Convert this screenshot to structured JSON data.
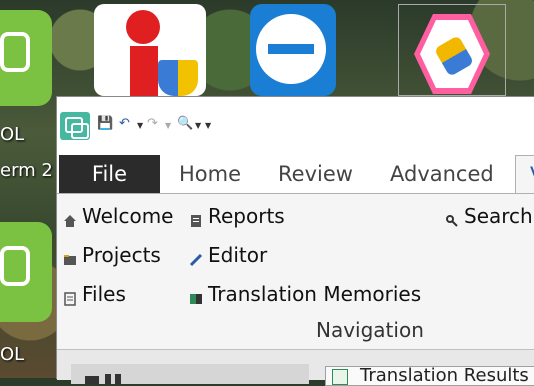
{
  "desktop": {
    "labels": [
      {
        "text": "OL"
      },
      {
        "text": "erm 2"
      },
      {
        "text": "OL"
      }
    ]
  },
  "window": {
    "quick_access": {
      "save": "save",
      "undo": "undo",
      "redo": "redo",
      "preview": "preview"
    },
    "tabs": {
      "file": "File",
      "home": "Home",
      "review": "Review",
      "advanced": "Advanced",
      "view": "V"
    },
    "ribbon": {
      "welcome": "Welcome",
      "reports": "Reports",
      "search": "Search",
      "projects": "Projects",
      "editor": "Editor",
      "files": "Files",
      "translation_memories": "Translation Memories",
      "group_label": "Navigation"
    },
    "bottom": {
      "result_tab": "Translation Results"
    }
  },
  "colors": {
    "file_tab_bg": "#2b2b2b",
    "accent": "#2a5aa8",
    "trados_green": "#46b8a0"
  }
}
